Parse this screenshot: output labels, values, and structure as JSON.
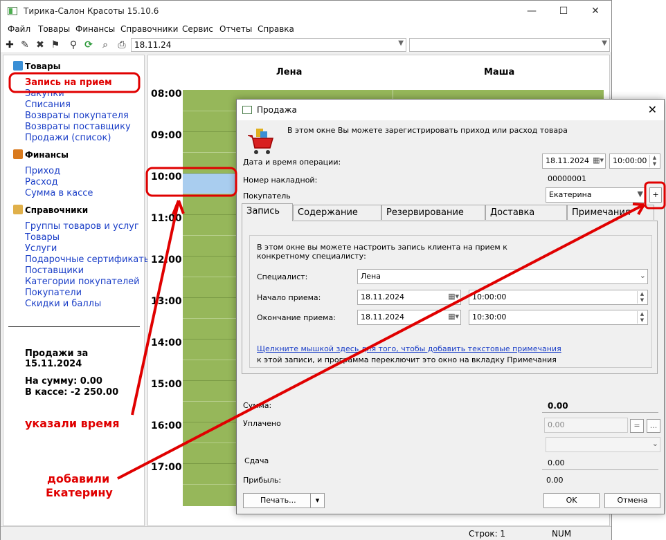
{
  "window": {
    "title": "Тирика-Салон Красоты 15.10.6",
    "minimize": "—",
    "maximize": "☐",
    "close": "✕"
  },
  "menu": [
    "Файл",
    "Товары",
    "Финансы",
    "Справочники",
    "Сервис",
    "Отчеты",
    "Справка"
  ],
  "toolbar": {
    "date_value": "18.11.24",
    "second_value": ""
  },
  "sidebar": {
    "goods": {
      "title": "Товары",
      "items": [
        "Запись на прием",
        "Закупки",
        "Списания",
        "Возвраты покупателя",
        "Возвраты поставщику",
        "Продажи (список)"
      ]
    },
    "finance": {
      "title": "Финансы",
      "items": [
        "Приход",
        "Расход",
        "Сумма в кассе"
      ]
    },
    "refs": {
      "title": "Справочники",
      "items": [
        "Группы товаров и услуг",
        "Товары",
        "Услуги",
        "Подарочные сертификаты",
        "Поставщики",
        "Категории покупателей",
        "Покупатели",
        "Скидки и баллы"
      ]
    },
    "sales_title": "Продажи за 15.11.2024",
    "sum_label": "На сумму: 0.00",
    "cash_label": "В кассе: -2 250.00"
  },
  "schedule": {
    "columns": [
      "Лена",
      "Маша"
    ],
    "hours": [
      "08:00",
      "09:00",
      "10:00",
      "11:00",
      "12:00",
      "13:00",
      "14:00",
      "15:00",
      "16:00",
      "17:00"
    ]
  },
  "status": {
    "rows": "Строк: 1",
    "num": "NUM"
  },
  "dialog": {
    "title": "Продажа",
    "intro": "В этом окне Вы можете зарегистрировать приход или расход товара",
    "datetime_label": "Дата и время операции:",
    "date": "18.11.2024",
    "time": "10:00:00",
    "invoice_label": "Номер накладной:",
    "invoice": "00000001",
    "buyer_label": "Покупатель",
    "buyer": "Екатерина",
    "tabs": [
      "Запись",
      "Содержание",
      "Резервирование",
      "Доставка",
      "Примечания"
    ],
    "panel": {
      "desc": "В этом окне вы можете настроить запись клиента на прием к конкретному специалисту:",
      "specialist_label": "Специалист:",
      "specialist": "Лена",
      "start_label": "Начало приема:",
      "start_date": "18.11.2024",
      "start_time": "10:00:00",
      "end_label": "Окончание приема:",
      "end_date": "18.11.2024",
      "end_time": "10:30:00",
      "notes_link": "Щелкните мышкой здесь для того, чтобы добавить текстовые примечания",
      "notes_text": "к этой записи, и программа переключит это окно на вкладку Примечания"
    },
    "sum_label": "Сумма:",
    "sum": "0.00",
    "paid_label": "Уплачено",
    "paid": "0.00",
    "eq_button": "=",
    "more_button": "...",
    "change_label": "Сдача",
    "change": "0.00",
    "profit_label": "Прибыль:",
    "profit": "0.00",
    "print_button": "Печать...",
    "ok_button": "OK",
    "cancel_button": "Отмена"
  },
  "annotations": {
    "time_note": "указали время",
    "buyer_note_1": "добавили",
    "buyer_note_2": "Екатерину"
  },
  "colors": {
    "accent_red": "#e00000",
    "grid_green": "#96b75a",
    "selection_blue": "#a9cdef",
    "link_blue": "#1a3ec7"
  }
}
